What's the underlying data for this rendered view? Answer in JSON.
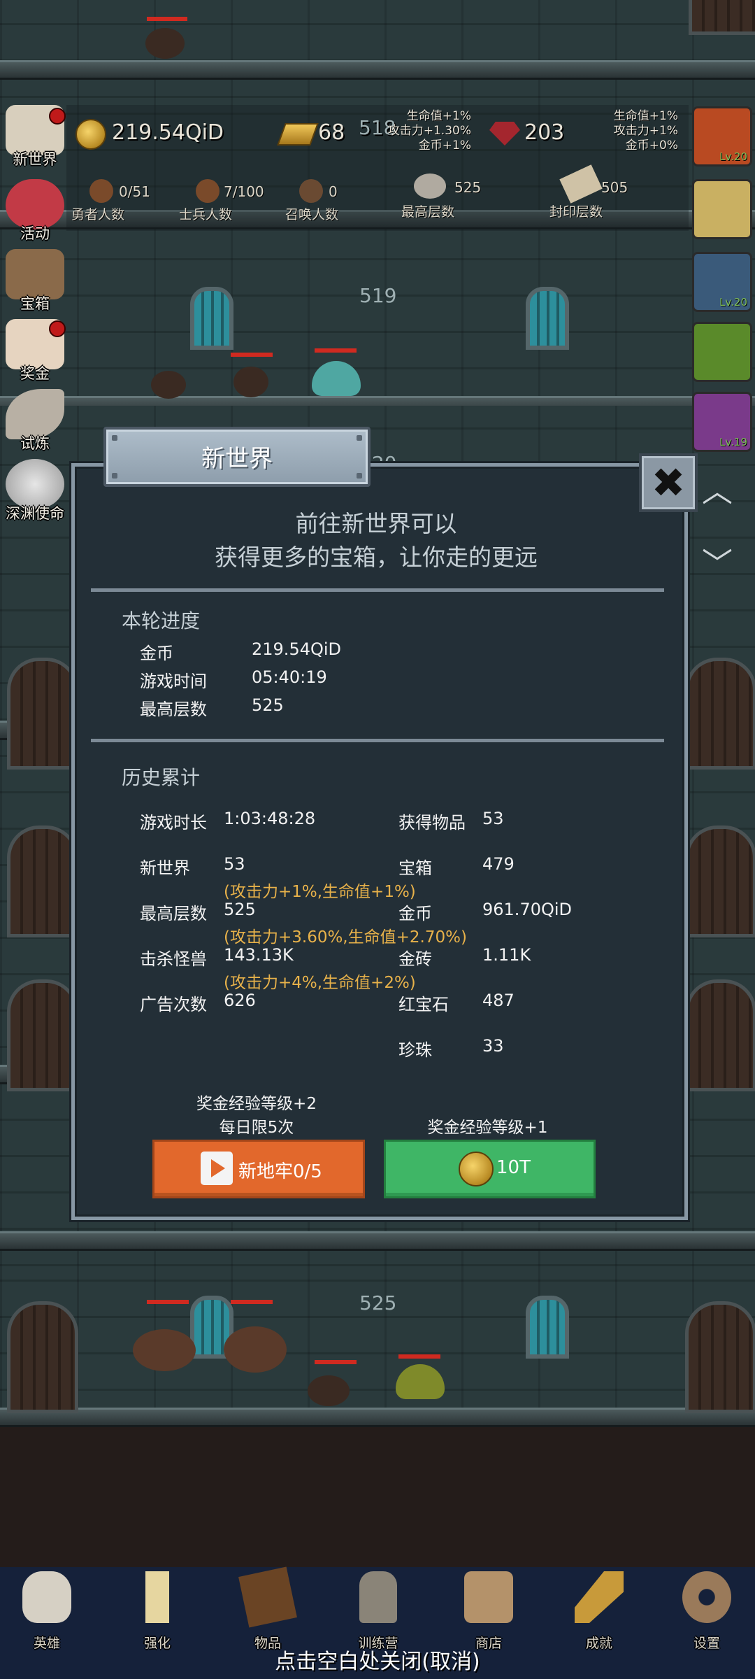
{
  "hud": {
    "gold": "219.54QiD",
    "gold_bar": "68",
    "floor_current": "518",
    "ruby": "203",
    "left_bonus": [
      "生命值+1%",
      "攻击力+1.30%",
      "金币+1%"
    ],
    "right_bonus": [
      "生命值+1%",
      "攻击力+1%",
      "金币+0%"
    ],
    "stats": [
      {
        "value": "0/51",
        "label": "勇者人数"
      },
      {
        "value": "7/100",
        "label": "士兵人数"
      },
      {
        "value": "0",
        "label": "召唤人数"
      },
      {
        "value": "525",
        "label": "最高层数"
      },
      {
        "value": "505",
        "label": "封印层数"
      }
    ]
  },
  "left_menu": [
    {
      "label": "新世界",
      "badge": true
    },
    {
      "label": "活动",
      "badge": false
    },
    {
      "label": "宝箱",
      "badge": false
    },
    {
      "label": "奖金",
      "badge": true
    },
    {
      "label": "试炼",
      "badge": false
    },
    {
      "label": "深渊使命",
      "badge": false
    }
  ],
  "right_menu": [
    {
      "level": "Lv.20"
    },
    {
      "level": ""
    },
    {
      "level": "Lv.20"
    },
    {
      "level": ""
    },
    {
      "level": "Lv.19"
    }
  ],
  "background_floors": {
    "floor_a": "519",
    "floor_b": "520",
    "floor_c": "525"
  },
  "dialog": {
    "title": "新世界",
    "close_glyph": "✖",
    "intro_line1": "前往新世界可以",
    "intro_line2": "获得更多的宝箱，让你走的更远",
    "current_round": {
      "title": "本轮进度",
      "rows": [
        {
          "label": "金币",
          "value": "219.54QiD"
        },
        {
          "label": "游戏时间",
          "value": "05:40:19"
        },
        {
          "label": "最高层数",
          "value": "525"
        }
      ]
    },
    "history": {
      "title": "历史累计",
      "left": [
        {
          "label": "游戏时长",
          "value": "1:03:48:28",
          "bonus": ""
        },
        {
          "label": "新世界",
          "value": "53",
          "bonus": "(攻击力+1%,生命值+1%)"
        },
        {
          "label": "最高层数",
          "value": "525",
          "bonus": "(攻击力+3.60%,生命值+2.70%)"
        },
        {
          "label": "击杀怪兽",
          "value": "143.13K",
          "bonus": "(攻击力+4%,生命值+2%)"
        },
        {
          "label": "广告次数",
          "value": "626",
          "bonus": ""
        }
      ],
      "right": [
        {
          "label": "获得物品",
          "value": "53"
        },
        {
          "label": "宝箱",
          "value": "479"
        },
        {
          "label": "金币",
          "value": "961.70QiD"
        },
        {
          "label": "金砖",
          "value": "1.11K"
        },
        {
          "label": "红宝石",
          "value": "487"
        },
        {
          "label": "珍珠",
          "value": "33"
        }
      ]
    },
    "ad_button": {
      "note1": "奖金经验等级+2",
      "note2": "每日限5次",
      "label": "新地牢0/5"
    },
    "gold_button": {
      "note": "奖金经验等级+1",
      "label": "10T"
    }
  },
  "right_arrows": {
    "up": "︿",
    "down": "﹀"
  },
  "bottom_nav": [
    "英雄",
    "强化",
    "物品",
    "训练营",
    "商店",
    "成就",
    "设置"
  ],
  "close_hint": "点击空白处关闭(取消)"
}
